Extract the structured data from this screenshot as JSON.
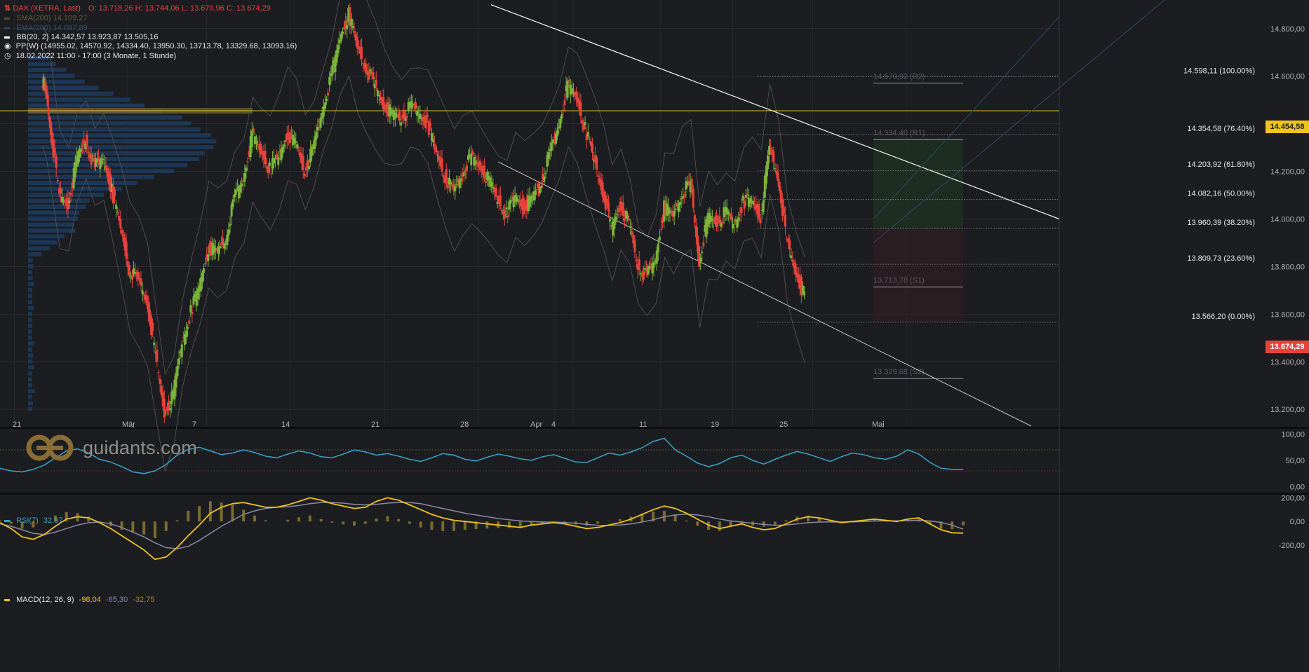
{
  "legend": {
    "title": "DAX (XETRA, Last)",
    "ohlc": "O: 13.718,26   H: 13.744,06   L: 13.670,96   C: 13.674,29",
    "sma": "SMA(200)  14.109,27",
    "ema": "EMA(200)  14.087,89",
    "bb": "BB(20, 2)  14.342,57  13.923,87  13.505,16",
    "pp": "PP(W)  (14955.02, 14570.92, 14334.40, 13950.30, 13713.78, 13329.68, 13093.16)",
    "range": "18.02.2022 11:00 - 17:00   (3 Monate, 1 Stunde)"
  },
  "current_price_tag": "13.674,29",
  "hline_price_tag": "14.454,58",
  "logo_text": "guidants.com",
  "colors": {
    "background": "#1b1d21",
    "bull": "#7db43a",
    "bear": "#e8433b",
    "rsi": "#3aa3c8",
    "macd": "#f0c419",
    "signal": "#8d89a5",
    "yellow_line": "#d9b22a",
    "current_tag": "#e8433b",
    "volume_profile": "#1d3b5e"
  },
  "indicators": {
    "rsi_label": "RSI(7)",
    "rsi_value": "32,97",
    "macd_label": "MACD(12, 26, 9)",
    "macd_value": "-98,04",
    "macd_signal": "-65,30",
    "macd_hist": "-32,75"
  },
  "chart_data": [
    {
      "type": "candlestick",
      "title": "DAX (XETRA, Last)",
      "ylim": [
        13130,
        14920
      ],
      "y_ticks": [
        "14.800,00",
        "14.600,00",
        "14.400,00",
        "14.200,00",
        "14.000,00",
        "13.800,00",
        "13.600,00",
        "13.400,00",
        "13.200,00"
      ],
      "y_tick_values": [
        14800,
        14600,
        14400,
        14200,
        14000,
        13800,
        13600,
        13400,
        13200
      ],
      "x_ticks": [
        "21",
        "Mär",
        "7",
        "14",
        "21",
        "28",
        "Apr",
        "4",
        "11",
        "19",
        "25",
        "Mai"
      ],
      "fib_levels": [
        {
          "label": "14.598,11 (100.00%)",
          "value": 14598.11
        },
        {
          "label": "14.354,58 (76.40%)",
          "value": 14354.58
        },
        {
          "label": "14.203,92 (61.80%)",
          "value": 14203.92
        },
        {
          "label": "14.082,16 (50.00%)",
          "value": 14082.16
        },
        {
          "label": "13.960,39 (38.20%)",
          "value": 13960.39
        },
        {
          "label": "13.809,73 (23.60%)",
          "value": 13809.73
        },
        {
          "label": "13.566,20 (0.00%)",
          "value": 13566.2
        }
      ],
      "pivot_levels": [
        {
          "label": "14.570,92 (R2)",
          "value": 14570.92
        },
        {
          "label": "14.334,40 (R1)",
          "value": 14334.4
        },
        {
          "label": "13.713,78 (S1)",
          "value": 13713.78
        },
        {
          "label": "13.329,68 (S2)",
          "value": 13329.68
        }
      ],
      "horizontal_line": 14454.58,
      "last_price": 13674.29,
      "close_path": [
        [
          0,
          14590
        ],
        [
          0.5,
          14520
        ],
        [
          1,
          14380
        ],
        [
          2,
          14100
        ],
        [
          3,
          14060
        ],
        [
          4,
          14250
        ],
        [
          5,
          14330
        ],
        [
          6,
          14220
        ],
        [
          7,
          14260
        ],
        [
          8,
          14120
        ],
        [
          9,
          13960
        ],
        [
          10,
          13790
        ],
        [
          11,
          13740
        ],
        [
          12,
          13660
        ],
        [
          13,
          13420
        ],
        [
          14,
          13180
        ],
        [
          15,
          13260
        ],
        [
          16,
          13480
        ],
        [
          17,
          13610
        ],
        [
          18,
          13720
        ],
        [
          19,
          13880
        ],
        [
          20,
          13860
        ],
        [
          21,
          13920
        ],
        [
          22,
          14090
        ],
        [
          23,
          14170
        ],
        [
          24,
          14350
        ],
        [
          25,
          14280
        ],
        [
          26,
          14210
        ],
        [
          27,
          14260
        ],
        [
          28,
          14360
        ],
        [
          29,
          14320
        ],
        [
          30,
          14200
        ],
        [
          31,
          14300
        ],
        [
          32,
          14460
        ],
        [
          33,
          14590
        ],
        [
          34,
          14760
        ],
        [
          35,
          14860
        ],
        [
          36,
          14720
        ],
        [
          37,
          14640
        ],
        [
          38,
          14560
        ],
        [
          39,
          14480
        ],
        [
          40,
          14440
        ],
        [
          41,
          14420
        ],
        [
          42,
          14470
        ],
        [
          43,
          14450
        ],
        [
          44,
          14400
        ],
        [
          45,
          14280
        ],
        [
          46,
          14180
        ],
        [
          47,
          14110
        ],
        [
          48,
          14200
        ],
        [
          49,
          14260
        ],
        [
          50,
          14220
        ],
        [
          51,
          14160
        ],
        [
          52,
          14080
        ],
        [
          53,
          14020
        ],
        [
          54,
          14100
        ],
        [
          55,
          14050
        ],
        [
          56,
          14090
        ],
        [
          57,
          14160
        ],
        [
          58,
          14280
        ],
        [
          59,
          14400
        ],
        [
          60,
          14560
        ],
        [
          61,
          14510
        ],
        [
          62,
          14380
        ],
        [
          63,
          14250
        ],
        [
          64,
          14120
        ],
        [
          65,
          13960
        ],
        [
          66,
          14060
        ],
        [
          67,
          13980
        ],
        [
          68,
          13800
        ],
        [
          69,
          13760
        ],
        [
          70,
          13830
        ],
        [
          71,
          14050
        ],
        [
          72,
          14010
        ],
        [
          73,
          14110
        ],
        [
          74,
          14150
        ],
        [
          75,
          13820
        ],
        [
          76,
          14010
        ],
        [
          77,
          13980
        ],
        [
          78,
          14030
        ],
        [
          79,
          13970
        ],
        [
          80,
          14070
        ],
        [
          81,
          14080
        ],
        [
          82,
          14010
        ],
        [
          83,
          14300
        ],
        [
          84,
          14180
        ],
        [
          85,
          13900
        ],
        [
          86,
          13780
        ],
        [
          87,
          13674
        ]
      ]
    },
    {
      "type": "line",
      "title": "RSI(7)",
      "ylim": [
        -10,
        110
      ],
      "y_ticks": [
        "100,00",
        "50,00",
        "0,00"
      ],
      "y_tick_values": [
        100,
        50,
        0
      ],
      "levels": [
        70,
        30
      ],
      "values": [
        35,
        30,
        28,
        33,
        41,
        55,
        68,
        72,
        64,
        52,
        47,
        38,
        28,
        25,
        30,
        42,
        60,
        71,
        75,
        68,
        61,
        64,
        70,
        65,
        58,
        55,
        62,
        68,
        64,
        57,
        55,
        62,
        70,
        66,
        60,
        63,
        58,
        52,
        48,
        55,
        63,
        60,
        52,
        49,
        56,
        62,
        58,
        53,
        50,
        57,
        61,
        54,
        47,
        46,
        55,
        64,
        60,
        66,
        74,
        86,
        92,
        70,
        58,
        45,
        38,
        44,
        55,
        60,
        50,
        43,
        52,
        60,
        67,
        62,
        55,
        48,
        57,
        64,
        61,
        55,
        52,
        58,
        70,
        62,
        46,
        35,
        33,
        32.97
      ]
    },
    {
      "type": "line",
      "title": "MACD(12, 26, 9)",
      "ylim": [
        -330,
        220
      ],
      "y_ticks": [
        "200,00",
        "0,00",
        "-200,00"
      ],
      "y_tick_values": [
        200,
        0,
        -200
      ],
      "macd": [
        -10,
        -60,
        -130,
        -150,
        -110,
        -40,
        20,
        40,
        30,
        -10,
        -60,
        -120,
        -180,
        -240,
        -320,
        -300,
        -220,
        -120,
        -30,
        70,
        120,
        150,
        160,
        140,
        120,
        120,
        140,
        170,
        200,
        180,
        150,
        130,
        110,
        120,
        170,
        200,
        180,
        140,
        100,
        60,
        30,
        10,
        0,
        -10,
        -20,
        -30,
        -40,
        -50,
        -30,
        -20,
        -10,
        -20,
        -40,
        -60,
        -50,
        -30,
        -10,
        20,
        60,
        100,
        130,
        110,
        70,
        20,
        -30,
        -60,
        -40,
        -20,
        -50,
        -70,
        -60,
        -20,
        20,
        40,
        30,
        10,
        -10,
        0,
        10,
        20,
        10,
        0,
        20,
        30,
        -20,
        -70,
        -95,
        -98.04
      ],
      "signal": [
        -20,
        -40,
        -70,
        -100,
        -110,
        -90,
        -60,
        -30,
        -10,
        -5,
        -20,
        -50,
        -90,
        -130,
        -180,
        -220,
        -230,
        -210,
        -160,
        -100,
        -40,
        10,
        60,
        90,
        110,
        120,
        125,
        135,
        150,
        160,
        160,
        155,
        145,
        140,
        145,
        155,
        160,
        160,
        150,
        130,
        110,
        90,
        70,
        55,
        40,
        25,
        15,
        5,
        0,
        -5,
        -5,
        -8,
        -15,
        -25,
        -32,
        -33,
        -30,
        -20,
        -5,
        15,
        40,
        55,
        62,
        55,
        40,
        20,
        5,
        -5,
        -15,
        -25,
        -32,
        -30,
        -20,
        -10,
        -5,
        -3,
        -4,
        -3,
        0,
        4,
        5,
        5,
        7,
        10,
        5,
        -8,
        -30,
        -65.3
      ]
    }
  ]
}
